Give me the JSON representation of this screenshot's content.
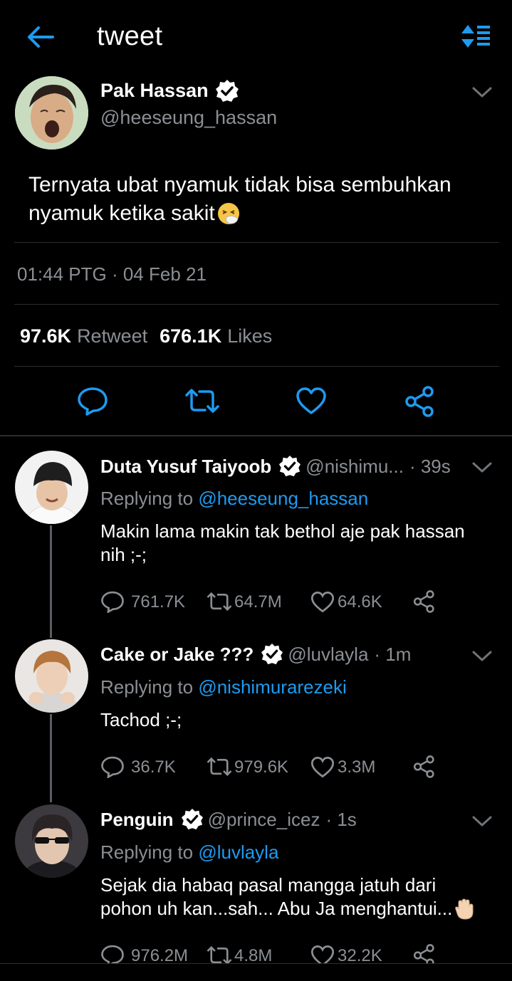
{
  "header": {
    "title": "tweet",
    "back_icon": "arrow-left-icon",
    "sort_icon": "sort-lines-icon"
  },
  "main_tweet": {
    "author_name": "Pak Hassan",
    "handle": "@heeseung_hassan",
    "text_line1": "Ternyata ubat nyamuk tidak bisa sembuhkan",
    "text_line2": "nyamuk ketika sakit",
    "emoji": "sneezing-face-emoji",
    "timestamp": "01:44 PTG · 04 Feb 21",
    "retweet_count": "97.6K",
    "retweet_label": "Retweet",
    "like_count": "676.1K",
    "like_label": "Likes"
  },
  "replies": [
    {
      "author_name": "Duta Yusuf Taiyoob",
      "handle": "@nishimu...",
      "time": "· 39s",
      "replying_label": "Replying to",
      "replying_to": "@heeseung_hassan",
      "text_line1": "Makin lama makin tak bethol aje pak hassan",
      "text_line2": "nih ;-;",
      "replies": "761.7K",
      "retweets": "64.7M",
      "likes": "64.6K"
    },
    {
      "author_name": "Cake or Jake ???",
      "handle": "@luvlayla",
      "time": "· 1m",
      "replying_label": "Replying to",
      "replying_to": "@nishimurarezeki",
      "text_line1": "Tachod ;-;",
      "replies": "36.7K",
      "retweets": "979.6K",
      "likes": "3.3M"
    },
    {
      "author_name": "Penguin",
      "handle": "@prince_icez",
      "time": "· 1s",
      "replying_label": "Replying to",
      "replying_to": "@luvlayla",
      "text_line1": "Sejak dia habaq pasal mangga jatuh dari",
      "text_line2": "pohon uh kan...sah... Abu Ja menghantui...",
      "emoji": "raised-hand-emoji",
      "replies": "976.2M",
      "retweets": "4.8M",
      "likes": "32.2K"
    }
  ],
  "colors": {
    "background": "#000000",
    "accent_blue": "#1d9bf0",
    "muted_text": "#8b8f94",
    "divider": "#2a2d31"
  }
}
